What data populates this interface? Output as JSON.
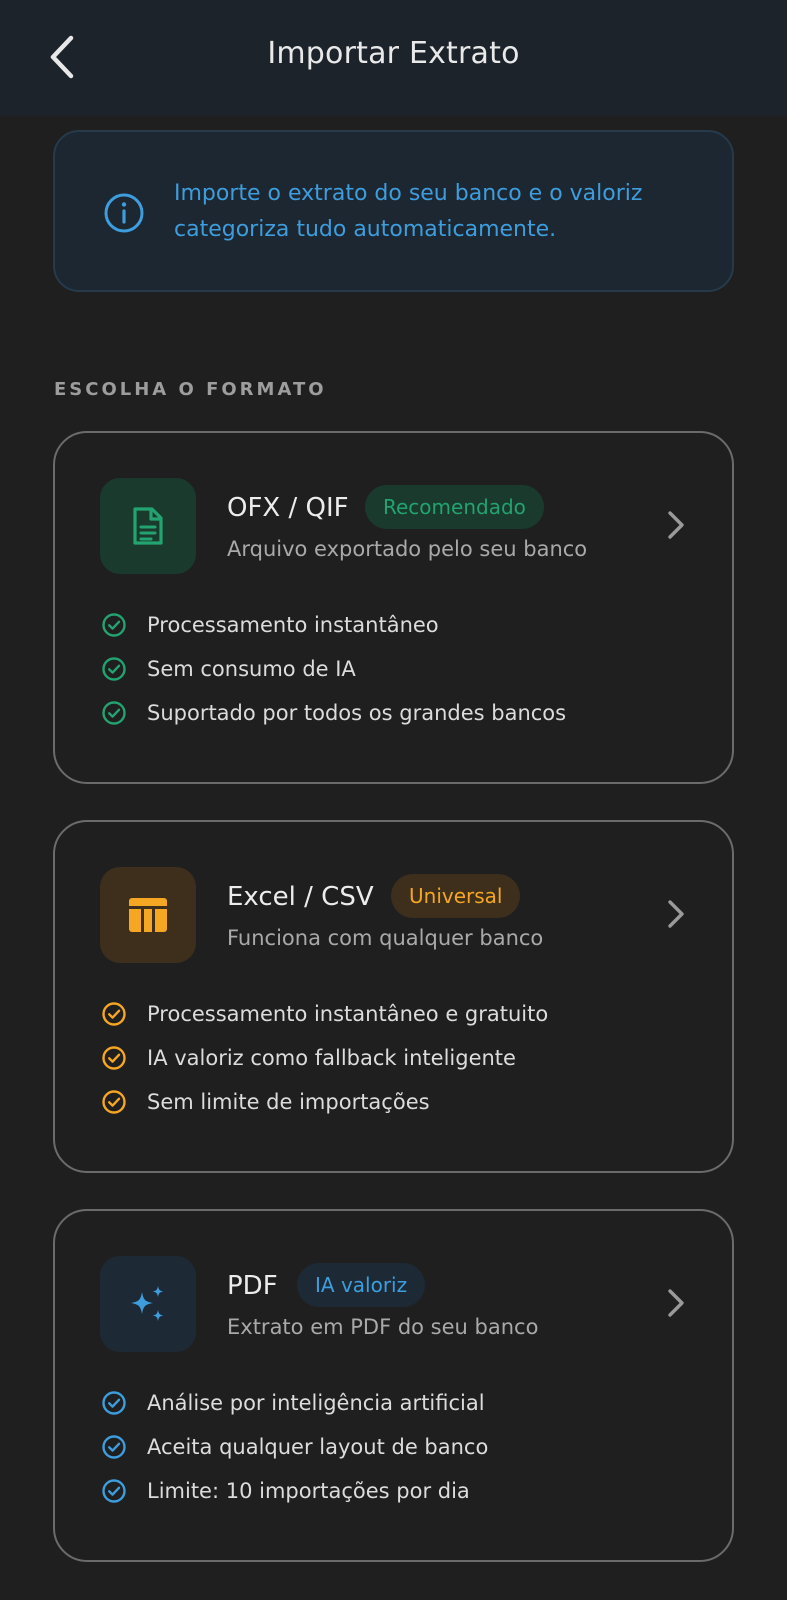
{
  "header": {
    "title": "Importar Extrato",
    "back_icon": "chevron-left-icon"
  },
  "info": {
    "icon": "info-icon",
    "text": "Importe o extrato do seu banco e o valoriz categoriza tudo automaticamente.",
    "color": "#3d9ddd"
  },
  "section": {
    "title": "ESCOLHA O FORMATO"
  },
  "cards": [
    {
      "title": "OFX / QIF",
      "badge": "Recomendado",
      "subtitle": "Arquivo exportado pelo seu banco",
      "icon": "document-icon",
      "accent": "#22a370",
      "features": [
        "Processamento instantâneo",
        "Sem consumo de IA",
        "Suportado por todos os grandes bancos"
      ]
    },
    {
      "title": "Excel / CSV",
      "badge": "Universal",
      "subtitle": "Funciona com qualquer banco",
      "icon": "spreadsheet-icon",
      "accent": "#f5a623",
      "features": [
        "Processamento instantâneo e gratuito",
        "IA valoriz como fallback inteligente",
        "Sem limite de importações"
      ]
    },
    {
      "title": "PDF",
      "badge": "IA valoriz",
      "subtitle": "Extrato em PDF do seu banco",
      "icon": "sparkles-icon",
      "accent": "#3d9ddd",
      "features": [
        "Análise por inteligência artificial",
        "Aceita qualquer layout de banco",
        "Limite: 10 importações por dia"
      ]
    }
  ]
}
